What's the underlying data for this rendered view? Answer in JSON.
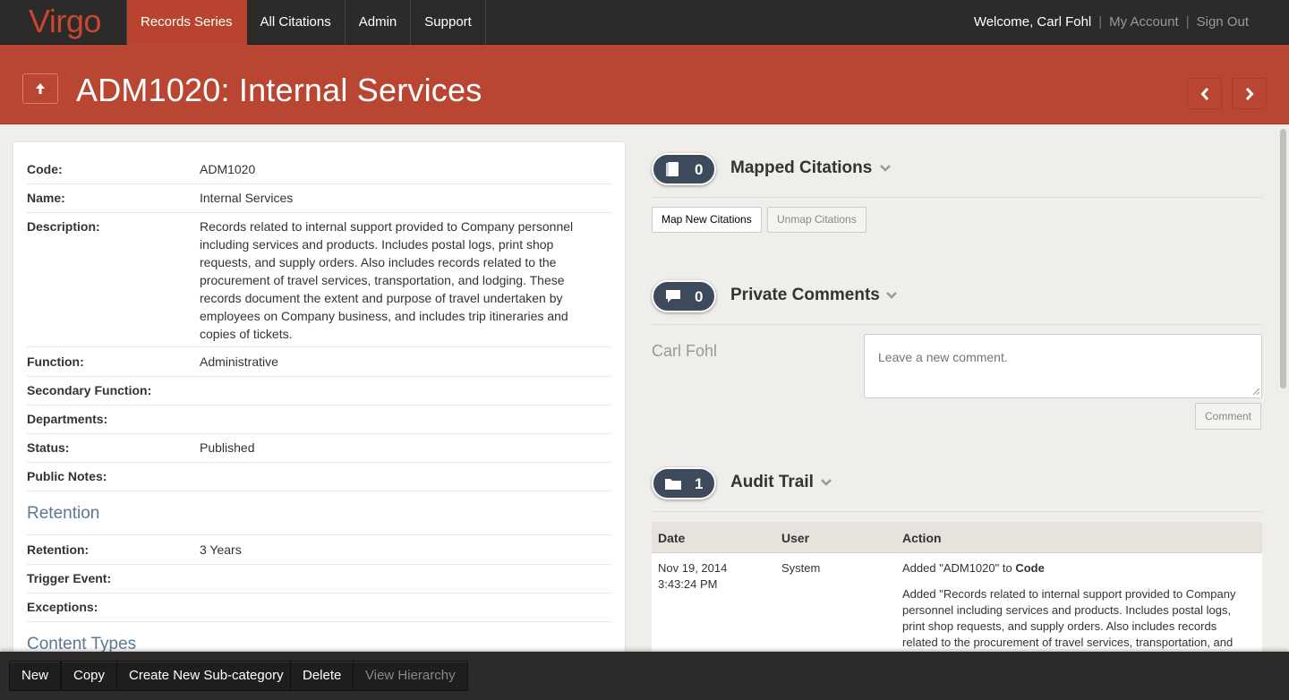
{
  "app": {
    "brand": "Virgo"
  },
  "nav": {
    "tabs": [
      {
        "label": "Records Series",
        "active": true
      },
      {
        "label": "All Citations"
      },
      {
        "label": "Admin"
      },
      {
        "label": "Support"
      }
    ],
    "welcome": "Welcome, Carl Fohl",
    "my_account": "My Account",
    "sign_out": "Sign Out"
  },
  "header": {
    "title": "ADM1020: Internal Services"
  },
  "record": {
    "fields": [
      {
        "label": "Code:",
        "value": "ADM1020"
      },
      {
        "label": "Name:",
        "value": "Internal Services"
      },
      {
        "label": "Description:",
        "value": "Records related to internal support provided to Company personnel including services and products. Includes postal logs, print shop requests, and supply orders. Also includes records related to the procurement of travel services, transportation, and lodging. These records document the extent and purpose of travel undertaken by employees on Company business, and includes trip itineraries and copies of tickets."
      },
      {
        "label": "Function:",
        "value": "Administrative"
      },
      {
        "label": "Secondary Function:",
        "value": ""
      },
      {
        "label": "Departments:",
        "value": ""
      },
      {
        "label": "Status:",
        "value": "Published"
      },
      {
        "label": "Public Notes:",
        "value": ""
      }
    ],
    "retention_heading": "Retention",
    "retention_fields": [
      {
        "label": "Retention:",
        "value": "3 Years"
      },
      {
        "label": "Trigger Event:",
        "value": ""
      },
      {
        "label": "Exceptions:",
        "value": ""
      }
    ],
    "content_types_heading": "Content Types"
  },
  "mapped_citations": {
    "count": "0",
    "title": "Mapped Citations",
    "map_button": "Map New Citations",
    "unmap_button": "Unmap Citations"
  },
  "private_comments": {
    "count": "0",
    "title": "Private Comments",
    "commenter": "Carl Fohl",
    "placeholder": "Leave a new comment.",
    "comment_button": "Comment"
  },
  "audit_trail": {
    "count": "1",
    "title": "Audit Trail",
    "columns": [
      "Date",
      "User",
      "Action"
    ],
    "rows": [
      {
        "date": "Nov 19, 2014",
        "time": "3:43:24 PM",
        "user": "System",
        "action_prefix": "Added \"ADM1020\" to ",
        "action_field": "Code",
        "action2": "Added \"Records related to internal support provided to Company personnel including services and products. Includes postal logs, print shop requests, and supply orders. Also includes records related to the procurement of travel services, transportation, and"
      }
    ]
  },
  "toolbar": {
    "new": "New",
    "copy": "Copy",
    "create_sub": "Create New Sub-category",
    "delete": "Delete",
    "view_hierarchy": "View Hierarchy"
  },
  "colors": {
    "accent": "#b84632",
    "nav_bg": "#2c2b29",
    "pill_bg": "#3d4a5c",
    "section_heading": "#5d7896"
  }
}
